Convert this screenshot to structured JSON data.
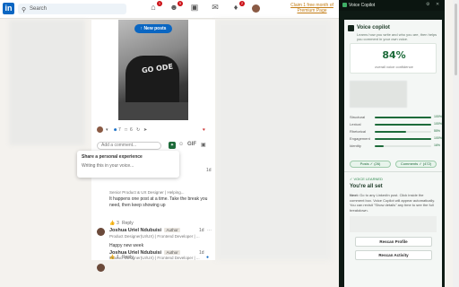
{
  "topbar": {
    "logo": "in",
    "search_placeholder": "Search",
    "badges": {
      "home": "1",
      "network": "5",
      "notifications": "2"
    },
    "premium_text": "Claim 1 free month of Premium Page"
  },
  "feed": {
    "image_text": "GO ODE",
    "new_posts_label": "New posts",
    "reactions_count": "7",
    "comments_count": "6",
    "comment_placeholder": "Add a comment...",
    "gif_label": "GIF",
    "popup": {
      "title": "Share a personal experience",
      "body": "Writing this in your voice..."
    },
    "comment1": {
      "headline": "Senior Product & UX Designer | Helping...",
      "text": "It happens one post at a time. Take the break you need, then keep showing up",
      "reply_label": "Reply",
      "likes": "3"
    },
    "comment2": {
      "name": "Joshua Uriel Ndubuisi",
      "author_tag": "Author",
      "time": "1d",
      "headline": "Product Designer(UI/UX) | Frontend Developer | ...",
      "text": "Happy new week",
      "reply_label": "Reply",
      "likes": "1"
    },
    "comment3": {
      "name": "Joshua Uriel Ndubuisi",
      "author_tag": "Author",
      "time": "1d",
      "headline": "Product Designer(UI/UX) | Frontend Developer | ..."
    },
    "comment_times": {
      "c1": "1d"
    }
  },
  "panel": {
    "header_title": "Voice Copilot",
    "title": "Voice copilot",
    "description": "Learns how you write and who you are, then helps you comment in your own voice.",
    "score": "84%",
    "score_label": "overall voice confidence",
    "metrics": [
      {
        "name": "Structural",
        "value": 100,
        "label": "100%"
      },
      {
        "name": "Lexical",
        "value": 100,
        "label": "100%"
      },
      {
        "name": "Rhetorical",
        "value": 55,
        "label": "55%"
      },
      {
        "name": "Engagement",
        "value": 100,
        "label": "100%"
      },
      {
        "name": "Identity",
        "value": 16,
        "label": "16%"
      }
    ],
    "tags": {
      "posts": "Posts ✓ (26)",
      "comments": "Comments ✓ (472)"
    },
    "learned_label": "✓ VOICE LEARNED",
    "all_set": "You're all set",
    "next_bold": "Next:",
    "next_text": "Go to any LinkedIn post. Click inside the comment box. Voice Copilot will appear automatically. You can revisit \"Show details\" any time to see the full breakdown.",
    "rescan_profile": "Rescan Profile",
    "rescan_activity": "Rescan Activity"
  },
  "colors": {
    "accent": "#1d6b3a",
    "linkedin_blue": "#0a66c2",
    "panel_dark": "#0e1a14"
  },
  "icons": [
    "search-icon",
    "home-icon",
    "network-icon",
    "jobs-icon",
    "messaging-icon",
    "notifications-icon",
    "pin-icon",
    "close-icon"
  ]
}
